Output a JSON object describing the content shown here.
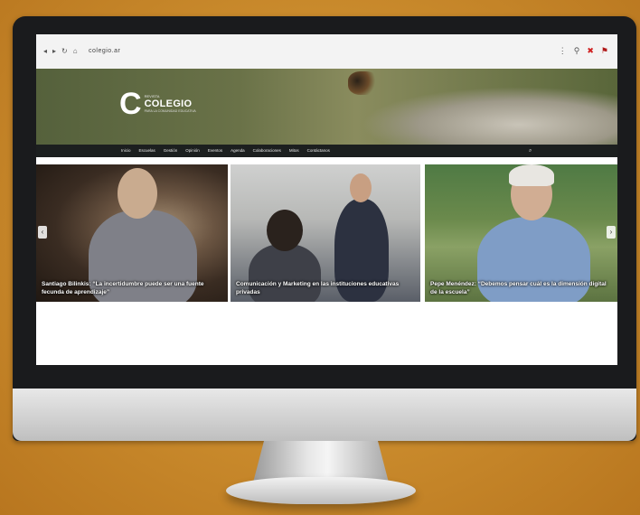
{
  "browser": {
    "nav": [
      "◂",
      "▸",
      "↻",
      "⌂"
    ],
    "url": "colegio.ar",
    "extensions": [
      "⋮",
      "⚲",
      "✖",
      "⚑"
    ]
  },
  "site": {
    "logo_letter": "C",
    "logo_small": "REVISTA",
    "logo_name": "COLEGIO",
    "logo_tagline": "PARA LA COMUNIDAD EDUCATIVA"
  },
  "menu": {
    "items": [
      "Inicio",
      "Escuelas",
      "Gestión",
      "Opinión",
      "Eventos",
      "Agenda",
      "Colaboraciones",
      "Mitos",
      "Contáctanos"
    ],
    "search_icon": "⌕"
  },
  "slides": [
    {
      "caption": "Santiago Bilinkis: “La incertidumbre puede ser una fuente fecunda de aprendizaje”"
    },
    {
      "caption": "Comunicación y Marketing en las instituciones educativas privadas"
    },
    {
      "caption": "Pepe Menéndez: “Debemos pensar cuál es la dimensión digital de la escuela”"
    }
  ],
  "slider_nav": {
    "prev": "‹",
    "next": "›"
  },
  "colors": {
    "background": "#c98a2c",
    "menubar": "#1c1f1f",
    "monitor_bezel": "#1a1b1d"
  }
}
